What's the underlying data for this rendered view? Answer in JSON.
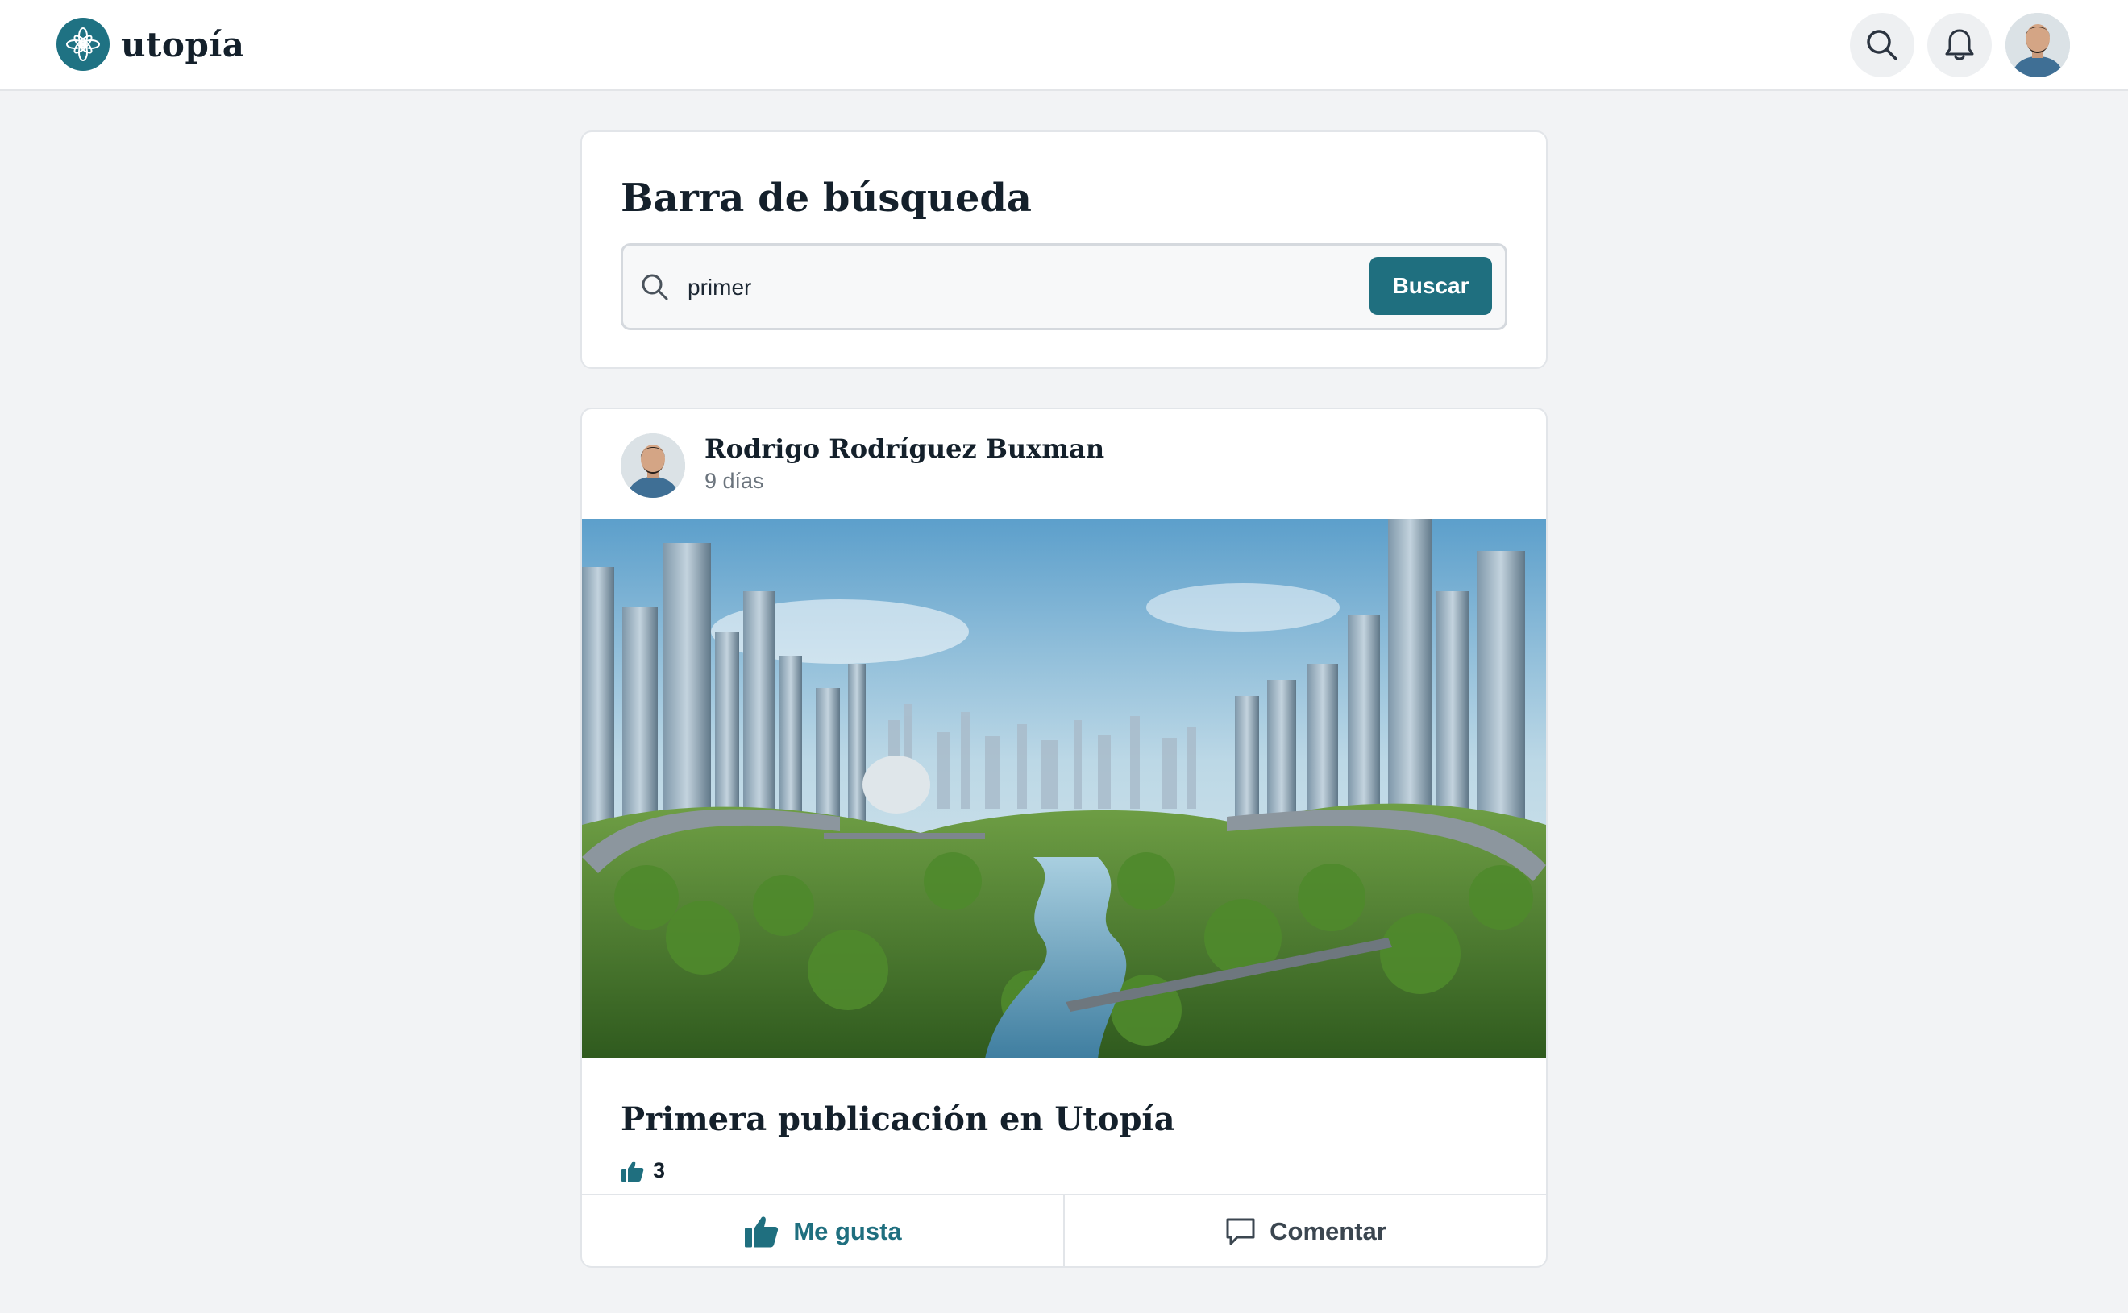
{
  "app": {
    "name": "utopía",
    "accent_color": "#1f6f7f"
  },
  "header": {
    "logo_text": "utopía",
    "search_icon": "search-icon",
    "notifications_icon": "bell-icon",
    "avatar": "user-avatar"
  },
  "search": {
    "title": "Barra de búsqueda",
    "query": "primer",
    "button_label": "Buscar"
  },
  "post": {
    "author": "Rodrigo Rodríguez Buxman",
    "time": "9 días",
    "image": "futuristic-green-city-image",
    "title": "Primera publicación en Utopía",
    "likes": "3",
    "actions": {
      "like_label": "Me gusta",
      "comment_label": "Comentar"
    }
  }
}
